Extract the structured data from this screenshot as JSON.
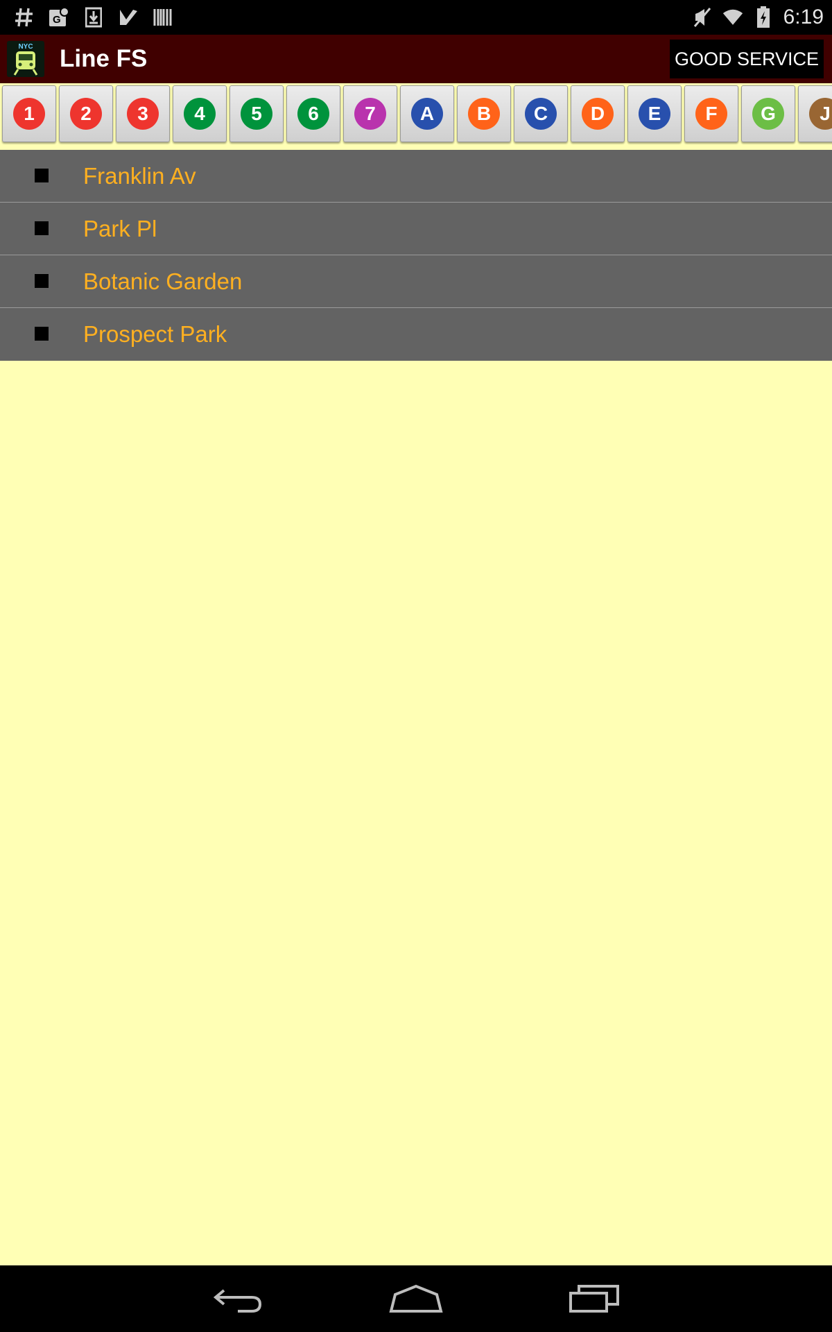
{
  "status_bar": {
    "time": "6:19",
    "left_icons": [
      "hash-icon",
      "maps-notification-icon",
      "download-icon",
      "play-store-icon",
      "barcode-icon"
    ],
    "right_icons": [
      "mute-icon",
      "wifi-icon",
      "battery-charging-icon"
    ]
  },
  "action_bar": {
    "title": "Line FS",
    "app_icon_text": "NYC",
    "status_label": "GOOD SERVICE"
  },
  "lines": [
    {
      "label": "1",
      "color": "#ee352e"
    },
    {
      "label": "2",
      "color": "#ee352e"
    },
    {
      "label": "3",
      "color": "#ee352e"
    },
    {
      "label": "4",
      "color": "#00933c"
    },
    {
      "label": "5",
      "color": "#00933c"
    },
    {
      "label": "6",
      "color": "#00933c"
    },
    {
      "label": "7",
      "color": "#b933ad"
    },
    {
      "label": "A",
      "color": "#2850ad"
    },
    {
      "label": "B",
      "color": "#ff6319"
    },
    {
      "label": "C",
      "color": "#2850ad"
    },
    {
      "label": "D",
      "color": "#ff6319"
    },
    {
      "label": "E",
      "color": "#2850ad"
    },
    {
      "label": "F",
      "color": "#ff6319"
    },
    {
      "label": "G",
      "color": "#6cbe45"
    },
    {
      "label": "J",
      "color": "#996633"
    }
  ],
  "stations": [
    {
      "name": "Franklin Av"
    },
    {
      "name": "Park Pl"
    },
    {
      "name": "Botanic Garden"
    },
    {
      "name": "Prospect Park"
    }
  ],
  "colors": {
    "background": "#ffffb5",
    "action_bar": "#400000",
    "station_row": "#636363",
    "station_text": "#ffb020"
  },
  "nav_bar": {
    "buttons": [
      "back-icon",
      "home-icon",
      "recent-apps-icon"
    ]
  }
}
